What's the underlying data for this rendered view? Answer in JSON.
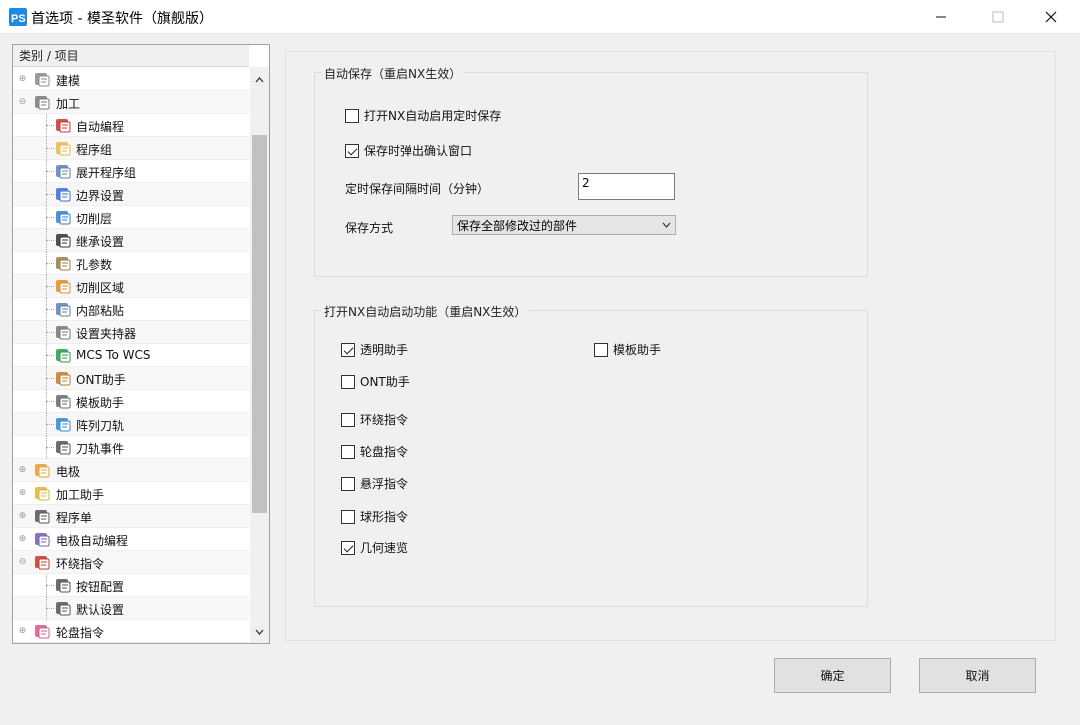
{
  "window": {
    "title": "首选项 - 模圣软件（旗舰版）"
  },
  "tree": {
    "header": "类别 / 项目",
    "items": [
      {
        "label": "建模",
        "level": 0,
        "expander": "+",
        "icon": "modeling-icon",
        "color": "#8a8a8a"
      },
      {
        "label": "加工",
        "level": 0,
        "expander": "-",
        "icon": "machining-icon",
        "color": "#7a7a7a"
      },
      {
        "label": "自动编程",
        "level": 1,
        "icon": "auto-program-icon",
        "color": "#c0392b"
      },
      {
        "label": "程序组",
        "level": 1,
        "icon": "program-group-icon",
        "color": "#e6b84a"
      },
      {
        "label": "展开程序组",
        "level": 1,
        "icon": "expand-program-group-icon",
        "color": "#5a7fb0"
      },
      {
        "label": "边界设置",
        "level": 1,
        "icon": "boundary-settings-icon",
        "color": "#3b6fd6"
      },
      {
        "label": "切削层",
        "level": 1,
        "icon": "cut-levels-icon",
        "color": "#2f7fd0"
      },
      {
        "label": "继承设置",
        "level": 1,
        "icon": "inherit-settings-icon",
        "color": "#333333"
      },
      {
        "label": "孔参数",
        "level": 1,
        "icon": "hole-params-icon",
        "color": "#9a7a4a"
      },
      {
        "label": "切削区域",
        "level": 1,
        "icon": "cut-area-icon",
        "color": "#e08a2a"
      },
      {
        "label": "内部粘贴",
        "level": 1,
        "icon": "internal-paste-icon",
        "color": "#5a7fb0"
      },
      {
        "label": "设置夹持器",
        "level": 1,
        "icon": "holder-settings-icon",
        "color": "#777777"
      },
      {
        "label": "MCS To WCS",
        "level": 1,
        "icon": "mcs-to-wcs-icon",
        "color": "#2a9a4a"
      },
      {
        "label": "ONT助手",
        "level": 1,
        "icon": "ont-assistant-icon",
        "color": "#c07a2a"
      },
      {
        "label": "模板助手",
        "level": 1,
        "icon": "template-assistant-icon",
        "color": "#6a6a6a"
      },
      {
        "label": "阵列刀轨",
        "level": 1,
        "icon": "array-toolpath-icon",
        "color": "#2a8ad0"
      },
      {
        "label": "刀轨事件",
        "level": 1,
        "icon": "toolpath-event-icon",
        "color": "#555555"
      },
      {
        "label": "电极",
        "level": 0,
        "expander": "+",
        "icon": "electrode-icon",
        "color": "#e0a030"
      },
      {
        "label": "加工助手",
        "level": 0,
        "expander": "+",
        "icon": "machining-assistant-icon",
        "color": "#e0b030"
      },
      {
        "label": "程序单",
        "level": 0,
        "expander": "+",
        "icon": "program-sheet-icon",
        "color": "#555555"
      },
      {
        "label": "电极自动编程",
        "level": 0,
        "expander": "+",
        "icon": "electrode-auto-program-icon",
        "color": "#7a5ab0"
      },
      {
        "label": "环绕指令",
        "level": 0,
        "expander": "-",
        "icon": "wrap-command-icon",
        "color": "#c0392b"
      },
      {
        "label": "按钮配置",
        "level": 1,
        "icon": "button-config-icon",
        "color": "#555555"
      },
      {
        "label": "默认设置",
        "level": 1,
        "icon": "default-settings-icon",
        "color": "#555555"
      },
      {
        "label": "轮盘指令",
        "level": 0,
        "expander": "+",
        "icon": "wheel-command-icon",
        "color": "#d05a8a"
      }
    ]
  },
  "autosave": {
    "title": "自动保存（重启NX生效）",
    "enable_timer_label": "打开NX自动启用定时保存",
    "enable_timer_checked": false,
    "confirm_popup_label": "保存时弹出确认窗口",
    "confirm_popup_checked": true,
    "interval_label": "定时保存间隔时间（分钟）",
    "interval_value": "2",
    "mode_label": "保存方式",
    "mode_value": "保存全部修改过的部件"
  },
  "autostart": {
    "title": "打开NX自动启动功能（重启NX生效）",
    "options": [
      {
        "label": "透明助手",
        "checked": true
      },
      {
        "label": "模板助手",
        "checked": false
      },
      {
        "label": "ONT助手",
        "checked": false
      },
      {
        "label": "环绕指令",
        "checked": false
      },
      {
        "label": "轮盘指令",
        "checked": false
      },
      {
        "label": "悬浮指令",
        "checked": false
      },
      {
        "label": "球形指令",
        "checked": false
      },
      {
        "label": "几何速览",
        "checked": true
      }
    ]
  },
  "buttons": {
    "ok": "确定",
    "cancel": "取消"
  }
}
